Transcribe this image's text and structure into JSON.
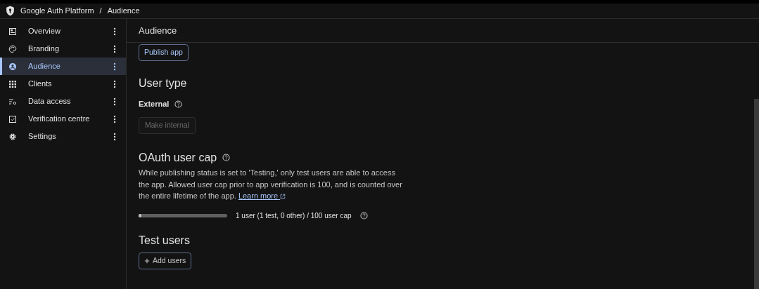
{
  "breadcrumb": [
    "Google Auth Platform",
    "/",
    "Audience"
  ],
  "sidebar": {
    "items": [
      {
        "label": "Overview",
        "selected": false
      },
      {
        "label": "Branding",
        "selected": false
      },
      {
        "label": "Audience",
        "selected": true
      },
      {
        "label": "Clients",
        "selected": false
      },
      {
        "label": "Data access",
        "selected": false
      },
      {
        "label": "Verification centre",
        "selected": false
      },
      {
        "label": "Settings",
        "selected": false
      }
    ]
  },
  "page_title": "Audience",
  "publish_button": "Publish app",
  "user_type": {
    "heading": "User type",
    "value": "External",
    "button": "Make internal",
    "button_disabled": true
  },
  "user_cap": {
    "heading": "OAuth user cap",
    "description": "While publishing status is set to 'Testing,' only test users are able to access the app. Allowed user cap prior to app verification is 100, and is counted over the entire lifetime of the app.",
    "link": "Learn more",
    "level": 0.01,
    "reading": "1 user (1 test, 0 other) / 100 user cap"
  },
  "test_users": {
    "heading": "Test users",
    "button": "Add users"
  }
}
